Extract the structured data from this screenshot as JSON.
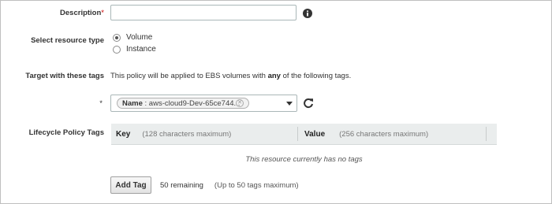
{
  "description": {
    "label": "Description",
    "required_mark": "*",
    "value": ""
  },
  "resource_type": {
    "label": "Select resource type",
    "options": [
      {
        "label": "Volume",
        "selected": true
      },
      {
        "label": "Instance",
        "selected": false
      }
    ]
  },
  "target_tags": {
    "label": "Target with these tags",
    "text_before": "This policy will be applied to EBS volumes with",
    "text_emphasis": "any",
    "text_after": "of the following tags."
  },
  "tag_select": {
    "required_mark": "*",
    "chip_key": "Name",
    "chip_separator": " : ",
    "chip_value": "aws-cloud9-Dev-65ce744..."
  },
  "lifecycle_tags": {
    "label": "Lifecycle Policy Tags",
    "columns": [
      {
        "name": "Key",
        "hint": "(128 characters maximum)"
      },
      {
        "name": "Value",
        "hint": "(256 characters maximum)"
      }
    ],
    "empty_message": "This resource currently has no tags"
  },
  "add_tag": {
    "button_label": "Add Tag",
    "remaining": "50 remaining",
    "limit_note": "(Up to 50 tags maximum)"
  }
}
